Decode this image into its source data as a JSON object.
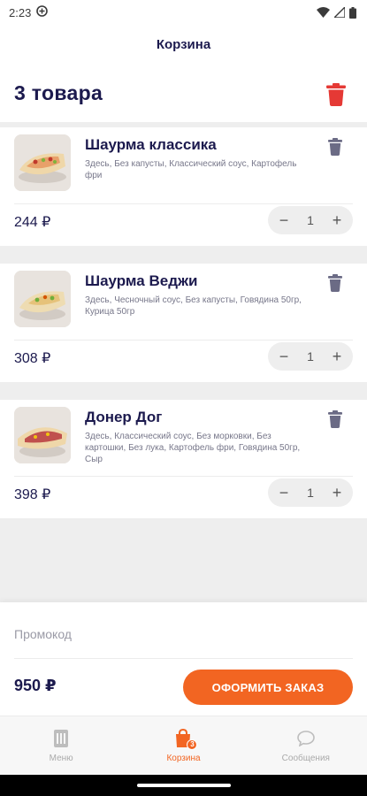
{
  "status_bar": {
    "time": "2:23"
  },
  "header": {
    "title": "Корзина"
  },
  "cart": {
    "count_label": "3 товара"
  },
  "items": [
    {
      "name": "Шаурма классика",
      "description": "Здесь, Без капусты, Классический соус, Картофель фри",
      "price": "244 ₽",
      "quantity": "1"
    },
    {
      "name": "Шаурма Веджи",
      "description": "Здесь, Чесночный соус, Без капусты, Говядина 50гр, Курица 50гр",
      "price": "308 ₽",
      "quantity": "1"
    },
    {
      "name": "Донер Дог",
      "description": "Здесь, Классический соус, Без морковки, Без картошки, Без лука, Картофель фри, Говядина 50гр, Сыр",
      "price": "398 ₽",
      "quantity": "1"
    }
  ],
  "stepper": {
    "minus": "−",
    "plus": "+"
  },
  "promo": {
    "placeholder": "Промокод"
  },
  "footer": {
    "total": "950 ₽",
    "checkout_label": "ОФОРМИТЬ ЗАКАЗ"
  },
  "nav": {
    "items": [
      {
        "label": "Меню",
        "icon": "menu-icon"
      },
      {
        "label": "Корзина",
        "icon": "cart-bag-icon",
        "badge": "3"
      },
      {
        "label": "Сообщения",
        "icon": "chat-icon"
      }
    ],
    "active": "Корзина"
  },
  "colors": {
    "accent": "#f26522",
    "primary_text": "#1c1a4e",
    "delete_red": "#e53935",
    "trash_gray": "#6b6b85"
  }
}
